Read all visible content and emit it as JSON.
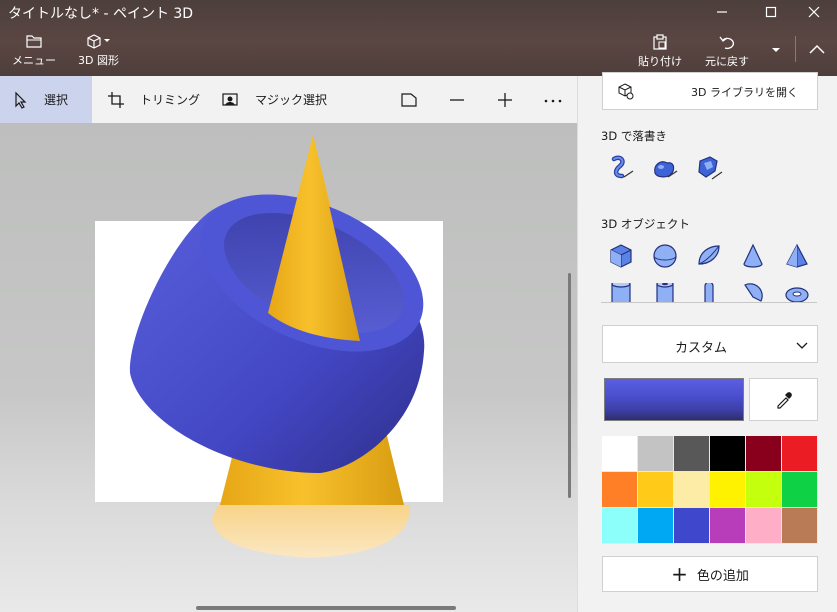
{
  "window": {
    "title": "タイトルなし* - ペイント 3D"
  },
  "commands": {
    "menu": "メニュー",
    "shapes3d": "3D 図形",
    "paste": "貼り付け",
    "undo": "元に戻す"
  },
  "toolbar": {
    "select": "選択",
    "trim": "トリミング",
    "magic_select": "マジック選択"
  },
  "panel": {
    "open_library": "3D ライブラリを開く",
    "doodle_title": "3D で落書き",
    "doodle_tools": [
      "tube-doodle-icon",
      "soft-doodle-icon",
      "sharp-doodle-icon"
    ],
    "objects_title": "3D オブジェクト",
    "objects": [
      "cube-icon",
      "sphere-icon",
      "hemisphere-icon",
      "cone-icon",
      "pyramid-icon"
    ],
    "objects_row2": [
      "cylinder-icon",
      "tube-icon",
      "capsule-icon",
      "pie-icon",
      "donut-icon"
    ],
    "material": "カスタム",
    "current_color": "#4b4fd0",
    "palette": [
      "#ffffff",
      "#c3c3c3",
      "#585858",
      "#000000",
      "#88001b",
      "#ec1c24",
      "#ff7f27",
      "#ffca18",
      "#fdeca6",
      "#fff200",
      "#c4ff0e",
      "#0ed145",
      "#8cfffb",
      "#00a8f3",
      "#3f48cc",
      "#b83dba",
      "#ffaec8",
      "#b97a56"
    ],
    "add_color": "色の追加"
  }
}
